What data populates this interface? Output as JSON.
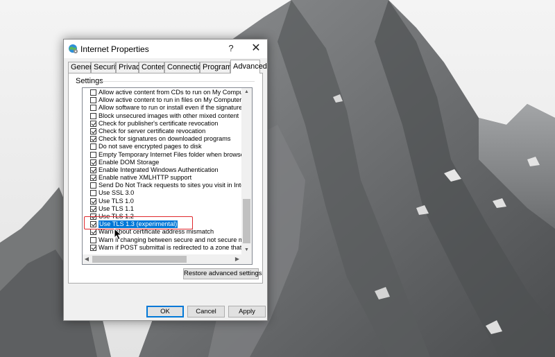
{
  "dialog": {
    "title": "Internet Properties",
    "help_label": "?",
    "close_label": "✕",
    "icon": "globe-settings-icon"
  },
  "tabs": [
    {
      "label": "General"
    },
    {
      "label": "Security"
    },
    {
      "label": "Privacy"
    },
    {
      "label": "Content"
    },
    {
      "label": "Connections"
    },
    {
      "label": "Programs"
    },
    {
      "label": "Advanced",
      "active": true
    }
  ],
  "settings": {
    "group_label": "Settings",
    "items": [
      {
        "label": "Allow active content from CDs to run on My Computer",
        "checked": false
      },
      {
        "label": "Allow active content to run in files on My Computer",
        "checked": false
      },
      {
        "label": "Allow software to run or install even if the signature is inv",
        "checked": false
      },
      {
        "label": "Block unsecured images with other mixed content",
        "checked": false
      },
      {
        "label": "Check for publisher's certificate revocation",
        "checked": true
      },
      {
        "label": "Check for server certificate revocation",
        "checked": true
      },
      {
        "label": "Check for signatures on downloaded programs",
        "checked": true
      },
      {
        "label": "Do not save encrypted pages to disk",
        "checked": false
      },
      {
        "label": "Empty Temporary Internet Files folder when browser is cl",
        "checked": false
      },
      {
        "label": "Enable DOM Storage",
        "checked": true
      },
      {
        "label": "Enable Integrated Windows Authentication",
        "checked": true
      },
      {
        "label": "Enable native XMLHTTP support",
        "checked": true
      },
      {
        "label": "Send Do Not Track requests to sites you visit in Internet E",
        "checked": false
      },
      {
        "label": "Use SSL 3.0",
        "checked": false
      },
      {
        "label": "Use TLS 1.0",
        "checked": true
      },
      {
        "label": "Use TLS 1.1",
        "checked": true
      },
      {
        "label": "Use TLS 1.2",
        "checked": true
      },
      {
        "label": "Use TLS 1.3 (experimental)",
        "checked": true,
        "selected": true
      },
      {
        "label": "Warn about certificate address mismatch",
        "checked": true
      },
      {
        "label": "Warn if changing between secure and not secure mode",
        "checked": false
      },
      {
        "label": "Warn if POST submittal is redirected to a zone that does i",
        "checked": true
      }
    ],
    "restore_label": "Restore advanced settings"
  },
  "footer": {
    "ok_label": "OK",
    "cancel_label": "Cancel",
    "apply_label": "Apply"
  },
  "colors": {
    "selection": "#0078d7",
    "highlight_box": "#e0262b"
  }
}
